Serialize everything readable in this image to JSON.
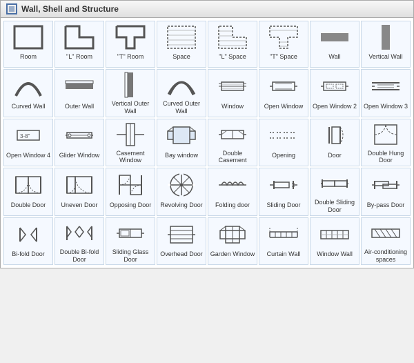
{
  "title": "Wall, Shell and Structure",
  "items": [
    {
      "label": "Room",
      "icon": "room"
    },
    {
      "label": "\"L\" Room",
      "icon": "l-room"
    },
    {
      "label": "\"T\" Room",
      "icon": "t-room"
    },
    {
      "label": "Space",
      "icon": "space"
    },
    {
      "label": "\"L\" Space",
      "icon": "l-space"
    },
    {
      "label": "\"T\" Space",
      "icon": "t-space"
    },
    {
      "label": "Wall",
      "icon": "wall"
    },
    {
      "label": "Vertical Wall",
      "icon": "vertical-wall"
    },
    {
      "label": "Curved Wall",
      "icon": "curved-wall"
    },
    {
      "label": "Outer Wall",
      "icon": "outer-wall"
    },
    {
      "label": "Vertical Outer Wall",
      "icon": "vertical-outer-wall"
    },
    {
      "label": "Curved Outer Wall",
      "icon": "curved-outer-wall"
    },
    {
      "label": "Window",
      "icon": "window"
    },
    {
      "label": "Open Window",
      "icon": "open-window"
    },
    {
      "label": "Open Window 2",
      "icon": "open-window-2"
    },
    {
      "label": "Open Window 3",
      "icon": "open-window-3"
    },
    {
      "label": "Open Window 4",
      "icon": "open-window-4"
    },
    {
      "label": "Glider Window",
      "icon": "glider-window"
    },
    {
      "label": "Casement Window",
      "icon": "casement-window"
    },
    {
      "label": "Bay window",
      "icon": "bay-window"
    },
    {
      "label": "Double Casement",
      "icon": "double-casement"
    },
    {
      "label": "Opening",
      "icon": "opening"
    },
    {
      "label": "Door",
      "icon": "door"
    },
    {
      "label": "Double Hung Door",
      "icon": "double-hung-door"
    },
    {
      "label": "Double Door",
      "icon": "double-door"
    },
    {
      "label": "Uneven Door",
      "icon": "uneven-door"
    },
    {
      "label": "Opposing Door",
      "icon": "opposing-door"
    },
    {
      "label": "Revolving Door",
      "icon": "revolving-door"
    },
    {
      "label": "Folding door",
      "icon": "folding-door"
    },
    {
      "label": "Sliding Door",
      "icon": "sliding-door"
    },
    {
      "label": "Double Sliding Door",
      "icon": "double-sliding-door"
    },
    {
      "label": "By-pass Door",
      "icon": "bypass-door"
    },
    {
      "label": "Bi-fold Door",
      "icon": "bifold-door"
    },
    {
      "label": "Double Bi-fold Door",
      "icon": "double-bifold-door"
    },
    {
      "label": "Sliding Glass Door",
      "icon": "sliding-glass-door"
    },
    {
      "label": "Overhead Door",
      "icon": "overhead-door"
    },
    {
      "label": "Garden Window",
      "icon": "garden-window"
    },
    {
      "label": "Curtain Wall",
      "icon": "curtain-wall"
    },
    {
      "label": "Window Wall",
      "icon": "window-wall"
    },
    {
      "label": "Air-conditioning spaces",
      "icon": "air-conditioning"
    }
  ]
}
